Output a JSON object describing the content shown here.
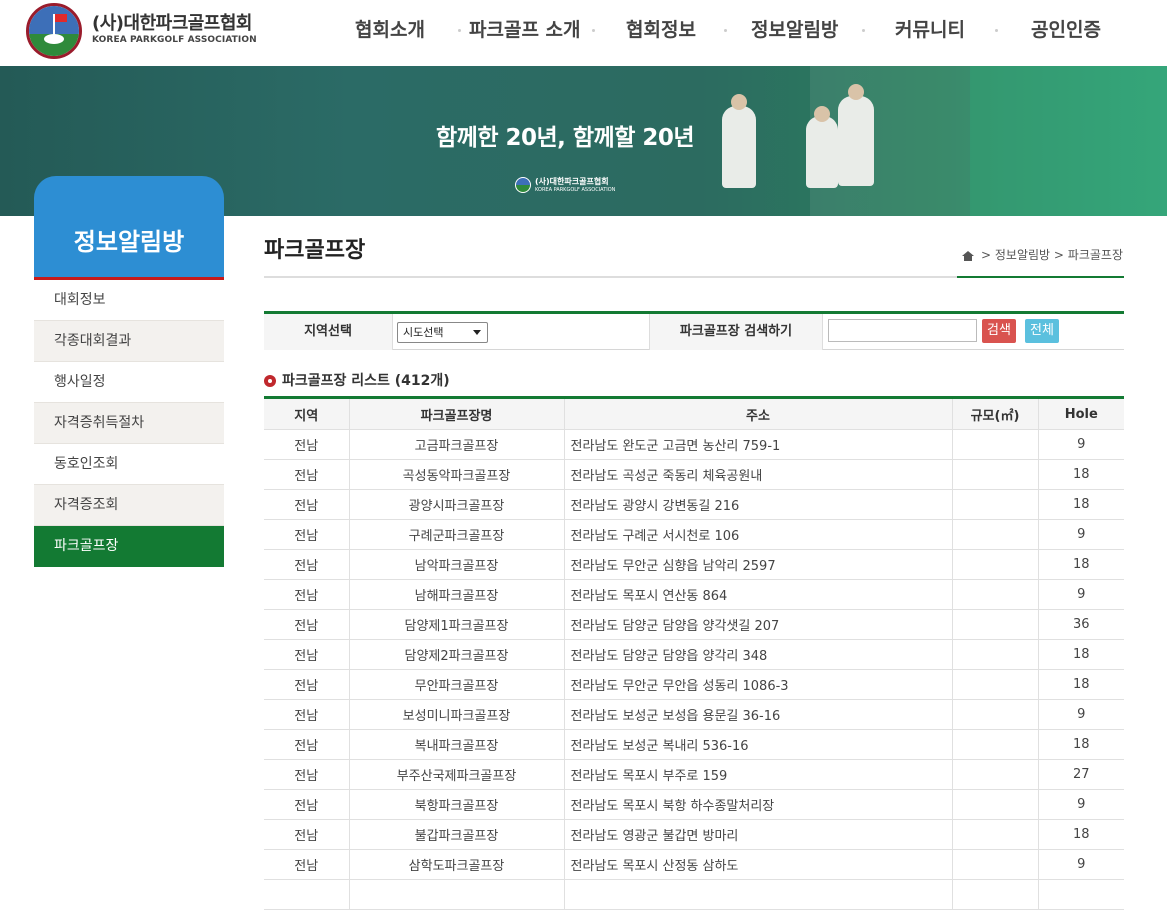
{
  "header": {
    "logo_text_ko": "(사)대한파크골프협회",
    "logo_text_en": "KOREA PARKGOLF ASSOCIATION",
    "nav": [
      "협회소개",
      "파크골프 소개",
      "협회정보",
      "정보알림방",
      "커뮤니티",
      "공인인증"
    ]
  },
  "banner": {
    "title": "함께한 20년, 함께할 20년",
    "logo_text_ko": "(사)대한파크골프협회",
    "logo_text_en": "KOREA PARKGOLF ASSOCIATION"
  },
  "sidebar": {
    "title": "정보알림방",
    "items": [
      "대회정보",
      "각종대회결과",
      "행사일정",
      "자격증취득절차",
      "동호인조회",
      "자격증조회",
      "파크골프장"
    ],
    "active_index": 6
  },
  "page": {
    "title": "파크골프장",
    "breadcrumb": [
      "정보알림방",
      "파크골프장"
    ],
    "breadcrumb_sep": ">"
  },
  "search": {
    "region_label": "지역선택",
    "region_value": "시도선택",
    "keyword_label": "파크골프장 검색하기",
    "keyword_value": "",
    "search_button": "검색",
    "all_button": "전체"
  },
  "list": {
    "title": "파크골프장 리스트 (412개)",
    "columns": [
      "지역",
      "파크골프장명",
      "주소",
      "규모(㎡)",
      "Hole"
    ],
    "rows": [
      [
        "전남",
        "고금파크골프장",
        "전라남도 완도군 고금면 농산리 759-1",
        "",
        "9"
      ],
      [
        "전남",
        "곡성동악파크골프장",
        "전라남도 곡성군 죽동리 체육공원내",
        "",
        "18"
      ],
      [
        "전남",
        "광양시파크골프장",
        "전라남도 광양시 강변동길 216",
        "",
        "18"
      ],
      [
        "전남",
        "구례군파크골프장",
        "전라남도 구례군 서시천로 106",
        "",
        "9"
      ],
      [
        "전남",
        "남악파크골프장",
        "전라남도 무안군 심향읍 남악리 2597",
        "",
        "18"
      ],
      [
        "전남",
        "남해파크골프장",
        "전라남도 목포시 연산동 864",
        "",
        "9"
      ],
      [
        "전남",
        "담양제1파크골프장",
        "전라남도 담양군 담양읍 양각샛길 207",
        "",
        "36"
      ],
      [
        "전남",
        "담양제2파크골프장",
        "전라남도 담양군 담양읍 양각리 348",
        "",
        "18"
      ],
      [
        "전남",
        "무안파크골프장",
        "전라남도 무안군 무안읍 성동리 1086-3",
        "",
        "18"
      ],
      [
        "전남",
        "보성미니파크골프장",
        "전라남도 보성군 보성읍 용문길 36-16",
        "",
        "9"
      ],
      [
        "전남",
        "복내파크골프장",
        "전라남도 보성군 복내리 536-16",
        "",
        "18"
      ],
      [
        "전남",
        "부주산국제파크골프장",
        "전라남도 목포시 부주로 159",
        "",
        "27"
      ],
      [
        "전남",
        "북항파크골프장",
        "전라남도 목포시 북항 하수종말처리장",
        "",
        "9"
      ],
      [
        "전남",
        "불갑파크골프장",
        "전라남도 영광군 불갑면 방마리",
        "",
        "18"
      ],
      [
        "전남",
        "삼학도파크골프장",
        "전라남도 목포시 산정동 삼하도",
        "",
        "9"
      ],
      [
        "",
        "",
        "",
        "",
        ""
      ]
    ]
  },
  "colors": {
    "brand_green": "#137a33",
    "sidebar_blue": "#2d8ed3",
    "accent_red": "#c71a1a",
    "search_btn": "#d9534f",
    "all_btn": "#5bc0de"
  }
}
